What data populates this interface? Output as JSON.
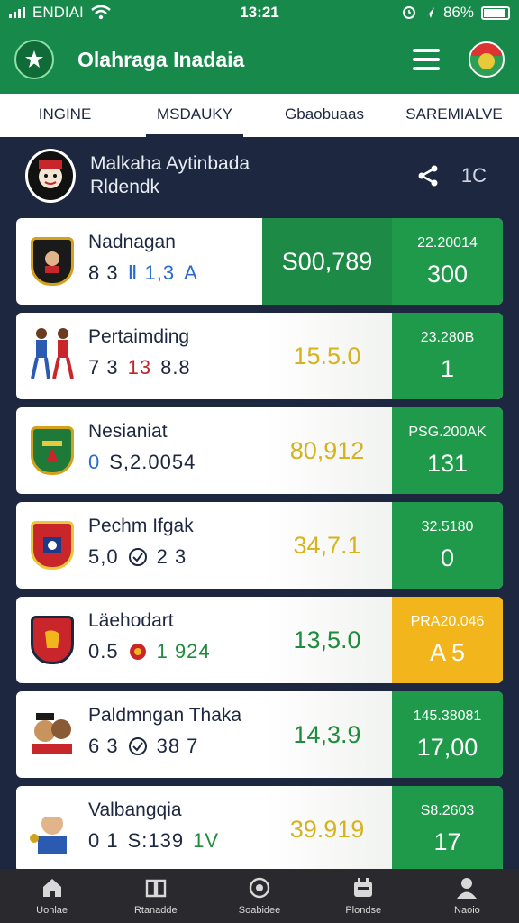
{
  "status": {
    "carrier": "ENDIAI",
    "time": "13:21",
    "battery": "86%"
  },
  "app": {
    "title": "Olahraga Inadaia"
  },
  "tabs": [
    {
      "label": "INGINE"
    },
    {
      "label": "MSDAUKY"
    },
    {
      "label": "Gbaobuaas"
    },
    {
      "label": "SAREMIALVE"
    }
  ],
  "league": {
    "line1": "Malkaha Aytinbada",
    "line2": "Rldendk",
    "count": "1C"
  },
  "cards": [
    {
      "name": "Nadnagan",
      "stats": [
        "8 3",
        "Ⅱ 1,3",
        "A"
      ],
      "middle": "S00,789",
      "right_small": "22.20014",
      "right_big": "300"
    },
    {
      "name": "Pertaimding",
      "stats": [
        "7 3",
        "13",
        "8.8"
      ],
      "middle": "15.5.0",
      "right_small": "23.280B",
      "right_big": "1"
    },
    {
      "name": "Nesianiat",
      "stats": [
        "0",
        "S,2.0054"
      ],
      "middle": "80,912",
      "right_small": "PSG.200AK",
      "right_big": "131"
    },
    {
      "name": "Pechm Ifgak",
      "stats": [
        "5,0",
        "2 3"
      ],
      "middle": "34,7.1",
      "right_small": "32.5180",
      "right_big": "0"
    },
    {
      "name": "Läehodart",
      "stats": [
        "0.5",
        "1 924"
      ],
      "middle": "13,5.0",
      "right_small": "PRA20.046",
      "right_big": "A 5"
    },
    {
      "name": "Paldmngan Thaka",
      "stats": [
        "6 3",
        "38 7"
      ],
      "middle": "14,3.9",
      "right_small": "145.38081",
      "right_big": "17,00"
    },
    {
      "name": "Valbangqia",
      "stats": [
        "0 1",
        "S:139",
        "1V"
      ],
      "middle": "39.919",
      "right_small": "S8.2603",
      "right_big": "17"
    }
  ],
  "nav": [
    {
      "label": "Uonlae"
    },
    {
      "label": "Rtanadde"
    },
    {
      "label": "Soabidee"
    },
    {
      "label": "Plondse"
    },
    {
      "label": "Naoio"
    }
  ],
  "colors": {
    "primary": "#17894a",
    "background": "#1d2740",
    "accent_yellow": "#f2b51c"
  }
}
